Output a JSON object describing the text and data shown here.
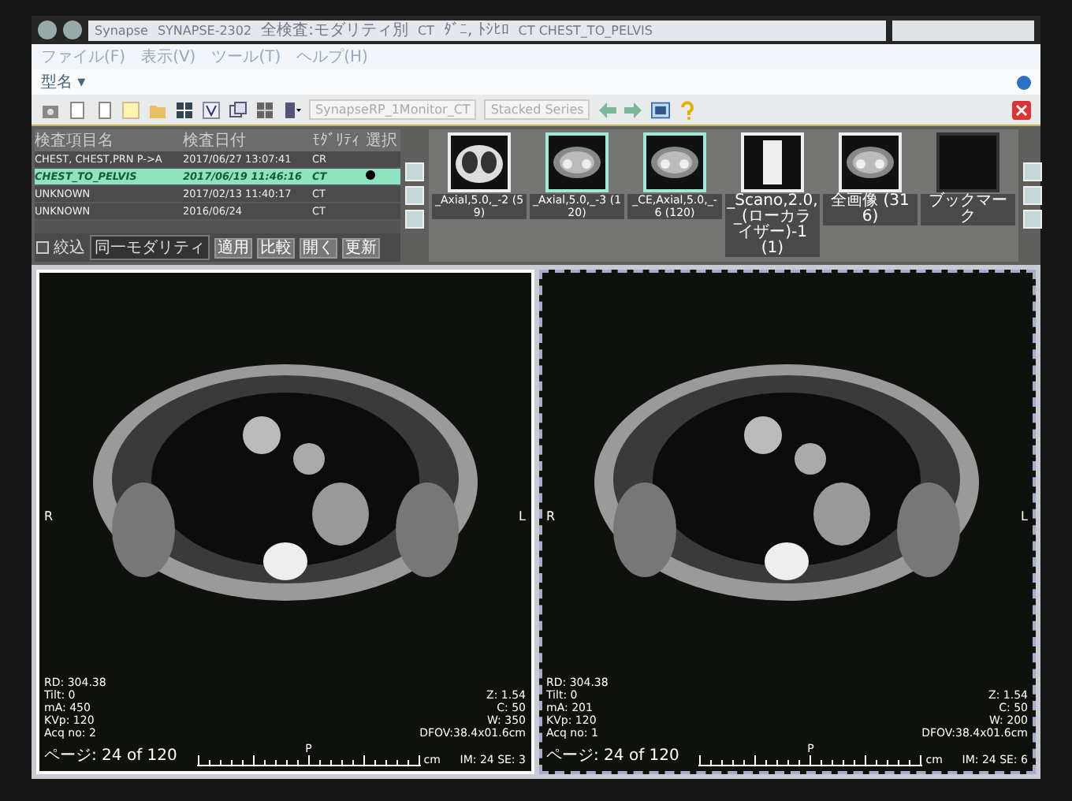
{
  "address_bar": {
    "path": [
      "Synapse",
      "SYNAPSE-2302",
      "全検査:モダリティ別",
      "CT",
      "ﾀﾞﾆ, ﾄｼﾋﾛ",
      "CT CHEST_TO_PELVIS"
    ]
  },
  "menu": [
    "ファイル(F)",
    "表示(V)",
    "ツール(T)",
    "ヘルプ(H)"
  ],
  "submenu": {
    "label": "型名 ▾"
  },
  "toolbar": {
    "layout_dropdown": "SynapseRP_1Monitor_CT",
    "series_dropdown": "Stacked Series"
  },
  "studies": {
    "columns": [
      "検査項目名",
      "検査日付",
      "ﾓﾀﾞﾘﾃｨ",
      "選択"
    ],
    "rows": [
      {
        "name": "CHEST, CHEST,PRN P->A",
        "date": "2017/06/27 13:07:41",
        "modality": "CR",
        "selected": false,
        "marked": false
      },
      {
        "name": "CHEST_TO_PELVIS",
        "date": "2017/06/19 11:46:16",
        "modality": "CT",
        "selected": true,
        "marked": true
      },
      {
        "name": "UNKNOWN",
        "date": "2017/02/13 11:40:17",
        "modality": "CT",
        "selected": false,
        "marked": false
      },
      {
        "name": "UNKNOWN",
        "date": "2016/06/24",
        "modality": "CT",
        "selected": false,
        "marked": false
      }
    ]
  },
  "filter": {
    "checked": false,
    "label": "絞込",
    "dropdown": "同一モダリティ",
    "buttons": [
      "適用",
      "比較",
      "開く",
      "更新"
    ]
  },
  "thumbnails": [
    {
      "caption": "_Axial,5.0,_-2 (59)",
      "kind": "lung",
      "selected": false
    },
    {
      "caption": "_Axial,5.0,_-3 (120)",
      "kind": "abdomen",
      "selected": true
    },
    {
      "caption": "_CE,Axial,5.0,_-6 (120)",
      "kind": "abdomen",
      "selected": true
    },
    {
      "caption": "_Scano,2.0,_(ローカライザー)-1 (1)",
      "kind": "scout",
      "selected": false
    },
    {
      "caption": "全画像 (316)",
      "kind": "abdomen",
      "selected": false
    },
    {
      "caption": "ブックマーク",
      "kind": "empty",
      "selected": false
    }
  ],
  "viewports": [
    {
      "active": false,
      "left_side": "R",
      "right_side": "L",
      "info_left": [
        "RD: 304.38",
        "Tilt: 0",
        "mA: 450",
        "KVp: 120",
        "Acq no: 2"
      ],
      "info_right": [
        "Z: 1.54",
        "C: 50",
        "W: 350",
        "DFOV:38.4x01.6cm"
      ],
      "page": "ページ: 24 of 120",
      "ruler_label": "P",
      "ruler_unit": "cm",
      "image_number": "IM: 24 SE: 3"
    },
    {
      "active": true,
      "left_side": "R",
      "right_side": "L",
      "info_left": [
        "RD: 304.38",
        "Tilt: 0",
        "mA: 201",
        "KVp: 120",
        "Acq no: 1"
      ],
      "info_right": [
        "Z: 1.54",
        "C: 50",
        "W: 200",
        "DFOV:38.4x01.6cm"
      ],
      "page": "ページ: 24 of 120",
      "ruler_label": "P",
      "ruler_unit": "cm",
      "image_number": "IM: 24 SE: 6"
    }
  ]
}
